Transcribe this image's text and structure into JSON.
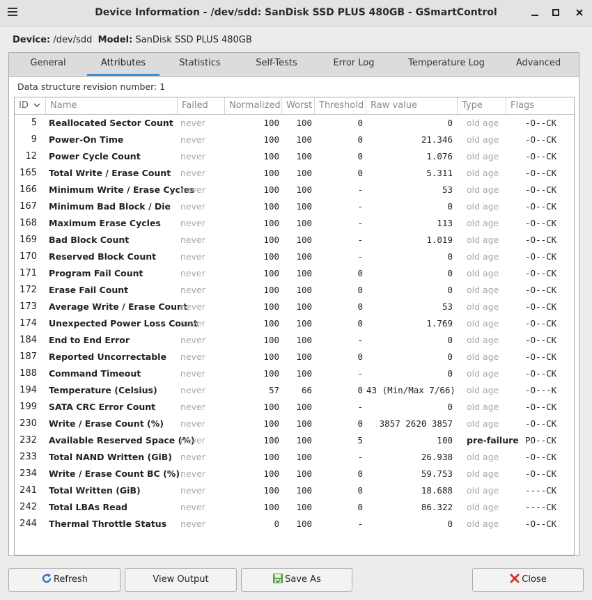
{
  "window": {
    "title": "Device Information - /dev/sdd: SanDisk SSD PLUS 480GB - GSmartControl",
    "menu_icon": "hamburger-menu-icon",
    "minimize_icon": "minimize-icon",
    "maximize_icon": "maximize-icon",
    "close_icon": "close-icon"
  },
  "device": {
    "device_label": "Device:",
    "device_value": "/dev/sdd",
    "model_label": "Model:",
    "model_value": "SanDisk SSD PLUS 480GB"
  },
  "tabs": [
    {
      "label": "General",
      "active": false
    },
    {
      "label": "Attributes",
      "active": true
    },
    {
      "label": "Statistics",
      "active": false
    },
    {
      "label": "Self-Tests",
      "active": false
    },
    {
      "label": "Error Log",
      "active": false
    },
    {
      "label": "Temperature Log",
      "active": false
    },
    {
      "label": "Advanced",
      "active": false
    }
  ],
  "revision_text": "Data structure revision number: 1",
  "columns": {
    "id": "ID",
    "name": "Name",
    "failed": "Failed",
    "normalized": "Normalized",
    "worst": "Worst",
    "threshold": "Threshold",
    "raw": "Raw value",
    "type": "Type",
    "flags": "Flags",
    "sort_icon": "chevron-down-icon"
  },
  "rows": [
    {
      "id": "5",
      "name": "Reallocated Sector Count",
      "failed": "never",
      "normalized": "100",
      "worst": "100",
      "threshold": "0",
      "raw": "0",
      "type": "old age",
      "flags": "-O--CK"
    },
    {
      "id": "9",
      "name": "Power-On Time",
      "failed": "never",
      "normalized": "100",
      "worst": "100",
      "threshold": "0",
      "raw": "21.346",
      "type": "old age",
      "flags": "-O--CK"
    },
    {
      "id": "12",
      "name": "Power Cycle Count",
      "failed": "never",
      "normalized": "100",
      "worst": "100",
      "threshold": "0",
      "raw": "1.076",
      "type": "old age",
      "flags": "-O--CK"
    },
    {
      "id": "165",
      "name": "Total Write / Erase Count",
      "failed": "never",
      "normalized": "100",
      "worst": "100",
      "threshold": "0",
      "raw": "5.311",
      "type": "old age",
      "flags": "-O--CK"
    },
    {
      "id": "166",
      "name": "Minimum Write / Erase Cycles",
      "failed": "never",
      "normalized": "100",
      "worst": "100",
      "threshold": "-",
      "raw": "53",
      "type": "old age",
      "flags": "-O--CK"
    },
    {
      "id": "167",
      "name": "Minimum Bad Block / Die",
      "failed": "never",
      "normalized": "100",
      "worst": "100",
      "threshold": "-",
      "raw": "0",
      "type": "old age",
      "flags": "-O--CK"
    },
    {
      "id": "168",
      "name": "Maximum Erase Cycles",
      "failed": "never",
      "normalized": "100",
      "worst": "100",
      "threshold": "-",
      "raw": "113",
      "type": "old age",
      "flags": "-O--CK"
    },
    {
      "id": "169",
      "name": "Bad Block Count",
      "failed": "never",
      "normalized": "100",
      "worst": "100",
      "threshold": "-",
      "raw": "1.019",
      "type": "old age",
      "flags": "-O--CK"
    },
    {
      "id": "170",
      "name": "Reserved Block Count",
      "failed": "never",
      "normalized": "100",
      "worst": "100",
      "threshold": "-",
      "raw": "0",
      "type": "old age",
      "flags": "-O--CK"
    },
    {
      "id": "171",
      "name": "Program Fail Count",
      "failed": "never",
      "normalized": "100",
      "worst": "100",
      "threshold": "0",
      "raw": "0",
      "type": "old age",
      "flags": "-O--CK"
    },
    {
      "id": "172",
      "name": "Erase Fail Count",
      "failed": "never",
      "normalized": "100",
      "worst": "100",
      "threshold": "0",
      "raw": "0",
      "type": "old age",
      "flags": "-O--CK"
    },
    {
      "id": "173",
      "name": "Average Write / Erase Count",
      "failed": "never",
      "normalized": "100",
      "worst": "100",
      "threshold": "0",
      "raw": "53",
      "type": "old age",
      "flags": "-O--CK"
    },
    {
      "id": "174",
      "name": "Unexpected Power Loss Count",
      "failed": "never",
      "normalized": "100",
      "worst": "100",
      "threshold": "0",
      "raw": "1.769",
      "type": "old age",
      "flags": "-O--CK"
    },
    {
      "id": "184",
      "name": "End to End Error",
      "failed": "never",
      "normalized": "100",
      "worst": "100",
      "threshold": "-",
      "raw": "0",
      "type": "old age",
      "flags": "-O--CK"
    },
    {
      "id": "187",
      "name": "Reported Uncorrectable",
      "failed": "never",
      "normalized": "100",
      "worst": "100",
      "threshold": "0",
      "raw": "0",
      "type": "old age",
      "flags": "-O--CK"
    },
    {
      "id": "188",
      "name": "Command Timeout",
      "failed": "never",
      "normalized": "100",
      "worst": "100",
      "threshold": "-",
      "raw": "0",
      "type": "old age",
      "flags": "-O--CK"
    },
    {
      "id": "194",
      "name": "Temperature (Celsius)",
      "failed": "never",
      "normalized": "57",
      "worst": "66",
      "threshold": "0",
      "raw": "43 (Min/Max 7/66)",
      "type": "old age",
      "flags": "-O---K"
    },
    {
      "id": "199",
      "name": "SATA CRC Error Count",
      "failed": "never",
      "normalized": "100",
      "worst": "100",
      "threshold": "-",
      "raw": "0",
      "type": "old age",
      "flags": "-O--CK"
    },
    {
      "id": "230",
      "name": "Write / Erase Count (%)",
      "failed": "never",
      "normalized": "100",
      "worst": "100",
      "threshold": "0",
      "raw": "3857 2620 3857",
      "type": "old age",
      "flags": "-O--CK"
    },
    {
      "id": "232",
      "name": "Available Reserved Space (%)",
      "failed": "never",
      "normalized": "100",
      "worst": "100",
      "threshold": "5",
      "raw": "100",
      "type": "pre-failure",
      "flags": "PO--CK"
    },
    {
      "id": "233",
      "name": "Total NAND Written (GiB)",
      "failed": "never",
      "normalized": "100",
      "worst": "100",
      "threshold": "-",
      "raw": "26.938",
      "type": "old age",
      "flags": "-O--CK"
    },
    {
      "id": "234",
      "name": "Write / Erase Count BC (%)",
      "failed": "never",
      "normalized": "100",
      "worst": "100",
      "threshold": "0",
      "raw": "59.753",
      "type": "old age",
      "flags": "-O--CK"
    },
    {
      "id": "241",
      "name": "Total Written (GiB)",
      "failed": "never",
      "normalized": "100",
      "worst": "100",
      "threshold": "0",
      "raw": "18.688",
      "type": "old age",
      "flags": "----CK"
    },
    {
      "id": "242",
      "name": "Total LBAs Read",
      "failed": "never",
      "normalized": "100",
      "worst": "100",
      "threshold": "0",
      "raw": "86.322",
      "type": "old age",
      "flags": "----CK"
    },
    {
      "id": "244",
      "name": "Thermal Throttle Status",
      "failed": "never",
      "normalized": "0",
      "worst": "100",
      "threshold": "-",
      "raw": "0",
      "type": "old age",
      "flags": "-O--CK"
    }
  ],
  "buttons": {
    "refresh": "Refresh",
    "refresh_icon": "refresh-icon",
    "view_output": "View Output",
    "save_as": "Save As",
    "save_icon": "save-icon",
    "close": "Close",
    "close_icon": "close-x-icon"
  },
  "colors": {
    "active_tab_underline": "#3d8fd9",
    "muted_text": "#a8a8a8",
    "close_icon": "#d9332b",
    "refresh_icon": "#2f74c6",
    "save_icon": "#4a9a3a"
  }
}
